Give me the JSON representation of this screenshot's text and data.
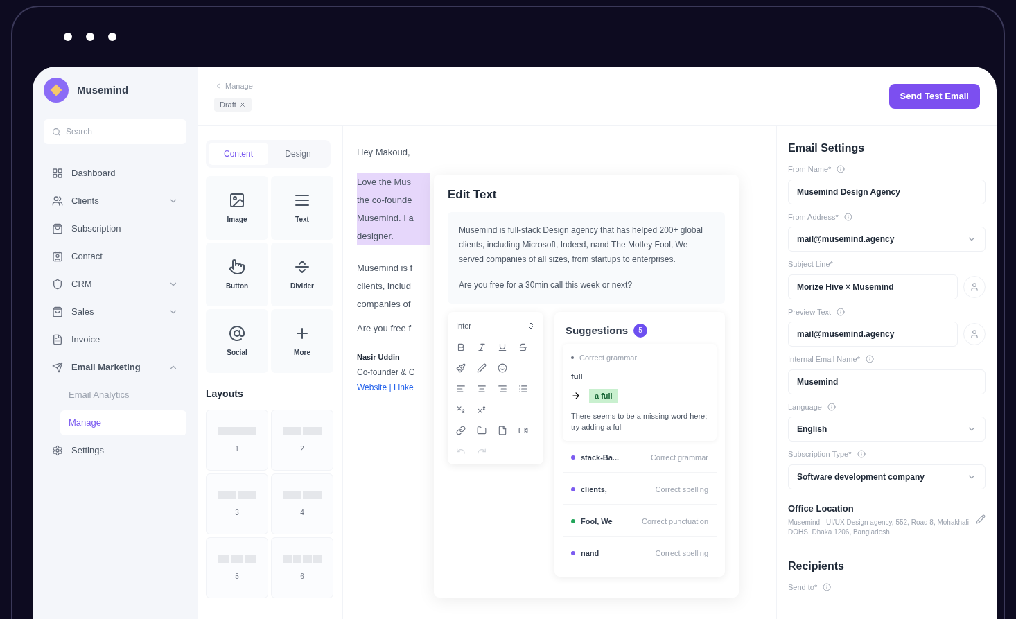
{
  "app": {
    "brand": "Musemind",
    "search": {
      "placeholder": "Search"
    }
  },
  "sidebar": {
    "items": [
      {
        "label": "Dashboard",
        "selected": false
      },
      {
        "label": "Clients",
        "selected": false,
        "expanded": false
      },
      {
        "label": "Subscription",
        "selected": false
      },
      {
        "label": "Contact",
        "selected": false
      },
      {
        "label": "CRM",
        "selected": false,
        "expanded": false
      },
      {
        "label": "Sales",
        "selected": false,
        "expanded": false
      },
      {
        "label": "Invoice",
        "selected": false
      },
      {
        "label": "Email Marketing",
        "selected": false,
        "expanded": true,
        "children": [
          {
            "label": "Email Analytics",
            "selected": false
          },
          {
            "label": "Manage",
            "selected": true
          }
        ]
      },
      {
        "label": "Settings",
        "selected": false
      }
    ]
  },
  "header": {
    "breadcrumb": "Manage",
    "status": "Draft",
    "action": "Send Test Email"
  },
  "builder": {
    "tabs": [
      {
        "label": "Content",
        "selected": true
      },
      {
        "label": "Design",
        "selected": false
      }
    ],
    "blocks": [
      {
        "label": "Image"
      },
      {
        "label": "Text"
      },
      {
        "label": "Button"
      },
      {
        "label": "Divider"
      },
      {
        "label": "Social"
      },
      {
        "label": "More"
      }
    ],
    "layouts_title": "Layouts",
    "layouts": [
      {
        "label": "1"
      },
      {
        "label": "2"
      },
      {
        "label": "3"
      },
      {
        "label": "4"
      },
      {
        "label": "5"
      },
      {
        "label": "6"
      }
    ]
  },
  "email": {
    "greeting": "Hey Makoud,",
    "highlighted_lines": [
      "Love the Mus",
      "the co-founde",
      "Musemind. I a",
      "designer."
    ],
    "body_lines": [
      "Musemind is f",
      "clients, includ",
      "companies of"
    ],
    "question": "Are you free f",
    "signature_name": "Nasir Uddin",
    "signature_role": "Co-founder & C",
    "signature_links": "Website | Linke"
  },
  "edit_text": {
    "title": "Edit Text",
    "paragraph": "Musemind is full-stack Design agency that has helped 200+ global clients, including Microsoft, Indeed, nand The Motley Fool, We served companies of all sizes, from startups to enterprises.",
    "question": "Are you free for a 30min call this week or next?",
    "font": "Inter"
  },
  "suggestions": {
    "title": "Suggestions",
    "count": "5",
    "active": {
      "type": "Correct grammar",
      "original": "full",
      "replacement": "a full",
      "explanation": "There seems to be a missing word here; try adding a full"
    },
    "items": [
      {
        "word": "stack-Ba...",
        "type": "Correct grammar",
        "color": "#7c5cf0"
      },
      {
        "word": "clients,",
        "type": "Correct spelling",
        "color": "#7c5cf0"
      },
      {
        "word": "Fool, We",
        "type": "Correct punctuation",
        "color": "#22a55a"
      },
      {
        "word": "nand",
        "type": "Correct spelling",
        "color": "#7c5cf0"
      }
    ]
  },
  "settings": {
    "title": "Email Settings",
    "fields": [
      {
        "label": "From Name*",
        "info": true,
        "kind": "text",
        "value": "Musemind Design Agency"
      },
      {
        "label": "From Address*",
        "info": true,
        "kind": "select",
        "value": "mail@musemind.agency"
      },
      {
        "label": "Subject Line*",
        "info": false,
        "kind": "person",
        "value": "Morize Hive × Musemind"
      },
      {
        "label": "Preview Text",
        "info": true,
        "kind": "person",
        "value": "mail@musemind.agency"
      },
      {
        "label": "Internal Email Name*",
        "info": true,
        "kind": "text",
        "value": "Musemind"
      },
      {
        "label": "Language",
        "info": true,
        "kind": "select",
        "value": "English"
      },
      {
        "label": "Subscription Type*",
        "info": true,
        "kind": "select",
        "value": "Software development company"
      }
    ],
    "office": {
      "title": "Office Location",
      "address": "Musemind - UI/UX Design agency, 552, Road 8, Mohakhali DOHS, Dhaka 1206, Bangladesh"
    },
    "recipients": {
      "title": "Recipients",
      "label": "Send to*",
      "info": true
    }
  }
}
